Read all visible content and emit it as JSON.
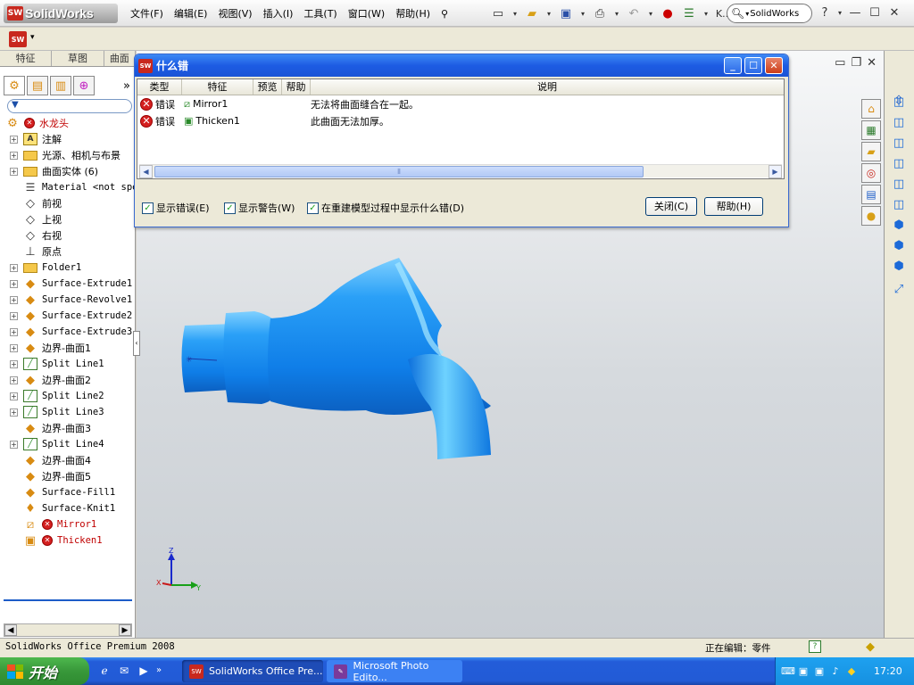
{
  "app": {
    "brand": "SolidWorks",
    "sw_badge": "SW"
  },
  "menu": [
    "文件(F)",
    "编辑(E)",
    "视图(V)",
    "插入(I)",
    "工具(T)",
    "窗口(W)",
    "帮助(H)"
  ],
  "toolbar": {
    "truncated": "K..",
    "search_text": "SolidWorks"
  },
  "left_panel": {
    "tabs": [
      "特征",
      "草图",
      "曲面"
    ],
    "more": "»",
    "tree": [
      {
        "label": "水龙头",
        "icon": "part-icon",
        "expand": "",
        "mono": false,
        "red": true
      },
      {
        "label": "注解",
        "icon": "annotation-icon",
        "expand": "+",
        "mono": false,
        "red": false
      },
      {
        "label": "光源、相机与布景",
        "icon": "folder-icon",
        "expand": "+",
        "mono": false,
        "red": false
      },
      {
        "label": "曲面实体 (6)",
        "icon": "surface-bodies-icon",
        "expand": "+",
        "mono": false,
        "red": false
      },
      {
        "label": "Material <not spe",
        "icon": "material-icon",
        "expand": "",
        "mono": true,
        "red": false
      },
      {
        "label": "前视",
        "icon": "plane-icon",
        "expand": "",
        "mono": false,
        "red": false
      },
      {
        "label": "上视",
        "icon": "plane-icon",
        "expand": "",
        "mono": false,
        "red": false
      },
      {
        "label": "右视",
        "icon": "plane-icon",
        "expand": "",
        "mono": false,
        "red": false
      },
      {
        "label": "原点",
        "icon": "origin-icon",
        "expand": "",
        "mono": false,
        "red": false
      },
      {
        "label": "Folder1",
        "icon": "folder-icon",
        "expand": "+",
        "mono": true,
        "red": false
      },
      {
        "label": "Surface-Extrude1",
        "icon": "feature-icon",
        "expand": "+",
        "mono": true,
        "red": false
      },
      {
        "label": "Surface-Revolve1",
        "icon": "feature-icon",
        "expand": "+",
        "mono": true,
        "red": false
      },
      {
        "label": "Surface-Extrude2",
        "icon": "feature-icon",
        "expand": "+",
        "mono": true,
        "red": false
      },
      {
        "label": "Surface-Extrude3",
        "icon": "feature-icon",
        "expand": "+",
        "mono": true,
        "red": false
      },
      {
        "label": "边界-曲面1",
        "icon": "feature-icon",
        "expand": "+",
        "mono": false,
        "red": false
      },
      {
        "label": "Split Line1",
        "icon": "split-line-icon",
        "expand": "+",
        "mono": true,
        "red": false
      },
      {
        "label": "边界-曲面2",
        "icon": "feature-icon",
        "expand": "+",
        "mono": false,
        "red": false
      },
      {
        "label": "Split Line2",
        "icon": "split-line-icon",
        "expand": "+",
        "mono": true,
        "red": false
      },
      {
        "label": "Split Line3",
        "icon": "split-line-icon",
        "expand": "+",
        "mono": true,
        "red": false
      },
      {
        "label": "边界-曲面3",
        "icon": "feature-icon",
        "expand": "",
        "mono": false,
        "red": false
      },
      {
        "label": "Split Line4",
        "icon": "split-line-icon",
        "expand": "+",
        "mono": true,
        "red": false
      },
      {
        "label": "边界-曲面4",
        "icon": "feature-icon",
        "expand": "",
        "mono": false,
        "red": false
      },
      {
        "label": "边界-曲面5",
        "icon": "feature-icon",
        "expand": "",
        "mono": false,
        "red": false
      },
      {
        "label": "Surface-Fill1",
        "icon": "feature-icon",
        "expand": "",
        "mono": true,
        "red": false
      },
      {
        "label": "Surface-Knit1",
        "icon": "knit-icon",
        "expand": "",
        "mono": true,
        "red": false
      },
      {
        "label": "Mirror1",
        "icon": "mirror-icon",
        "expand": "",
        "mono": true,
        "red": true
      },
      {
        "label": "Thicken1",
        "icon": "thicken-icon",
        "expand": "",
        "mono": true,
        "red": true
      }
    ]
  },
  "dialog": {
    "title": "什么错",
    "columns": [
      "类型",
      "特征",
      "预览",
      "帮助",
      "说明"
    ],
    "rows": [
      {
        "type": "错误",
        "feature": "Mirror1",
        "description": "无法将曲面缝合在一起。"
      },
      {
        "type": "错误",
        "feature": "Thicken1",
        "description": "此曲面无法加厚。"
      }
    ],
    "checkboxes": [
      {
        "label": "显示错误(E)",
        "checked": true
      },
      {
        "label": "显示警告(W)",
        "checked": true
      },
      {
        "label": "在重建模型过程中显示什么错(D)",
        "checked": true
      }
    ],
    "close_button": "关闭(C)",
    "help_button": "帮助(H)"
  },
  "triad": {
    "z": "Z",
    "y": "Y",
    "x": "X"
  },
  "status": {
    "left": "SolidWorks Office Premium 2008",
    "editing": "正在编辑：零件",
    "help": "?"
  },
  "taskbar": {
    "start": "开始",
    "tasks": [
      "SolidWorks Office Pre...",
      "Microsoft Photo Edito..."
    ],
    "clock": "17:20"
  },
  "colors": {
    "model": "#1a8ff0",
    "error": "#d42020",
    "taskbar": "#225bd6"
  }
}
